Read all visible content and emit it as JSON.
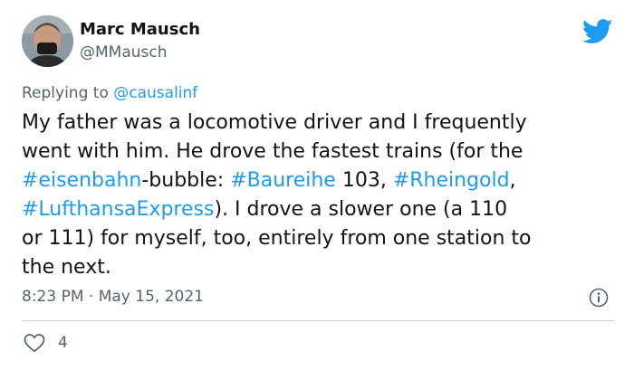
{
  "author": {
    "name": "Marc Mausch",
    "handle": "@MMausch",
    "avatar_icon": "profile-photo-avatar"
  },
  "brand": {
    "icon": "twitter-bird-icon",
    "color": "#1d9bf0"
  },
  "reply": {
    "prefix": "Replying to ",
    "mention": "@causalinf"
  },
  "body": {
    "l1": "My father was a locomotive driver and I frequently",
    "l2": "went with him. He drove the fastest trains (for the",
    "l3_tag1": "#eisenbahn",
    "l3_text1": "-bubble: ",
    "l3_tag2": "#Baureihe",
    "l3_text2": " 103, ",
    "l3_tag3": "#Rheingold",
    "l3_text3": ",",
    "l4_tag1": "#LufthansaExpress",
    "l4_text1": "). I drove a slower one (a 110",
    "l5": "or 111) for myself, too, entirely from one station to",
    "l6": "the next."
  },
  "meta": {
    "timestamp": "8:23 PM · May 15, 2021",
    "info_icon": "info-icon"
  },
  "actions": {
    "like_icon": "heart-icon",
    "like_count": "4"
  },
  "colors": {
    "text": "#0f1419",
    "secondary": "#536471",
    "link": "#1d9bf0",
    "divider": "#cfd9de"
  }
}
